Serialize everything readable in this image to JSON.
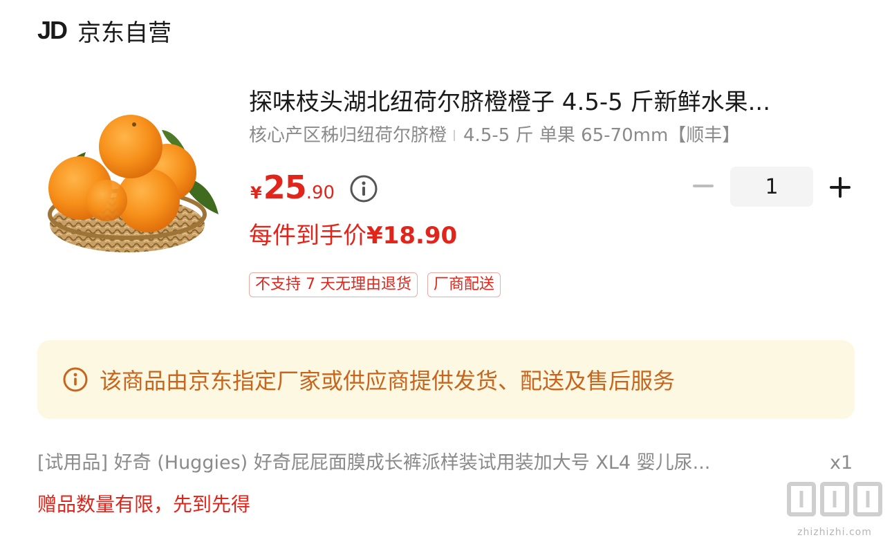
{
  "header": {
    "logo_text": "JD",
    "store_name": "京东自营"
  },
  "product": {
    "image_alt_icon": "orange-basket-image",
    "title": "探味枝头湖北纽荷尔脐橙橙子 4.5-5 斤新鲜水果...",
    "spec_part1": "核心产区秭归纽荷尔脐橙",
    "spec_part2": "4.5-5 斤 单果 65-70mm【顺丰】",
    "price_symbol": "¥",
    "price_integer": "25",
    "price_decimal": ".90",
    "net_price_label": "每件到手价",
    "net_price_amount": "¥18.90",
    "tags": [
      "不支持 7 天无理由退货",
      "厂商配送"
    ]
  },
  "quantity": {
    "minus_icon": "minus-icon",
    "value": "1",
    "plus_icon": "plus-icon"
  },
  "notice": {
    "icon": "info-icon",
    "text": "该商品由京东指定厂家或供应商提供发货、配送及售后服务"
  },
  "gift": {
    "title": "[试用品] 好奇 (Huggies) 好奇屁屁面膜成长裤派样装试用装加大号 XL4 婴儿尿...",
    "qty": "x1",
    "limit_text": "赠品数量有限，先到先得"
  },
  "watermark": {
    "main": "值|值|值",
    "url": "zhizhizhi.com"
  },
  "colors": {
    "price_red": "#e1251b",
    "notice_bg": "#fdf8e1",
    "notice_text": "#c7651e",
    "muted_gray": "#8a8a8a"
  }
}
